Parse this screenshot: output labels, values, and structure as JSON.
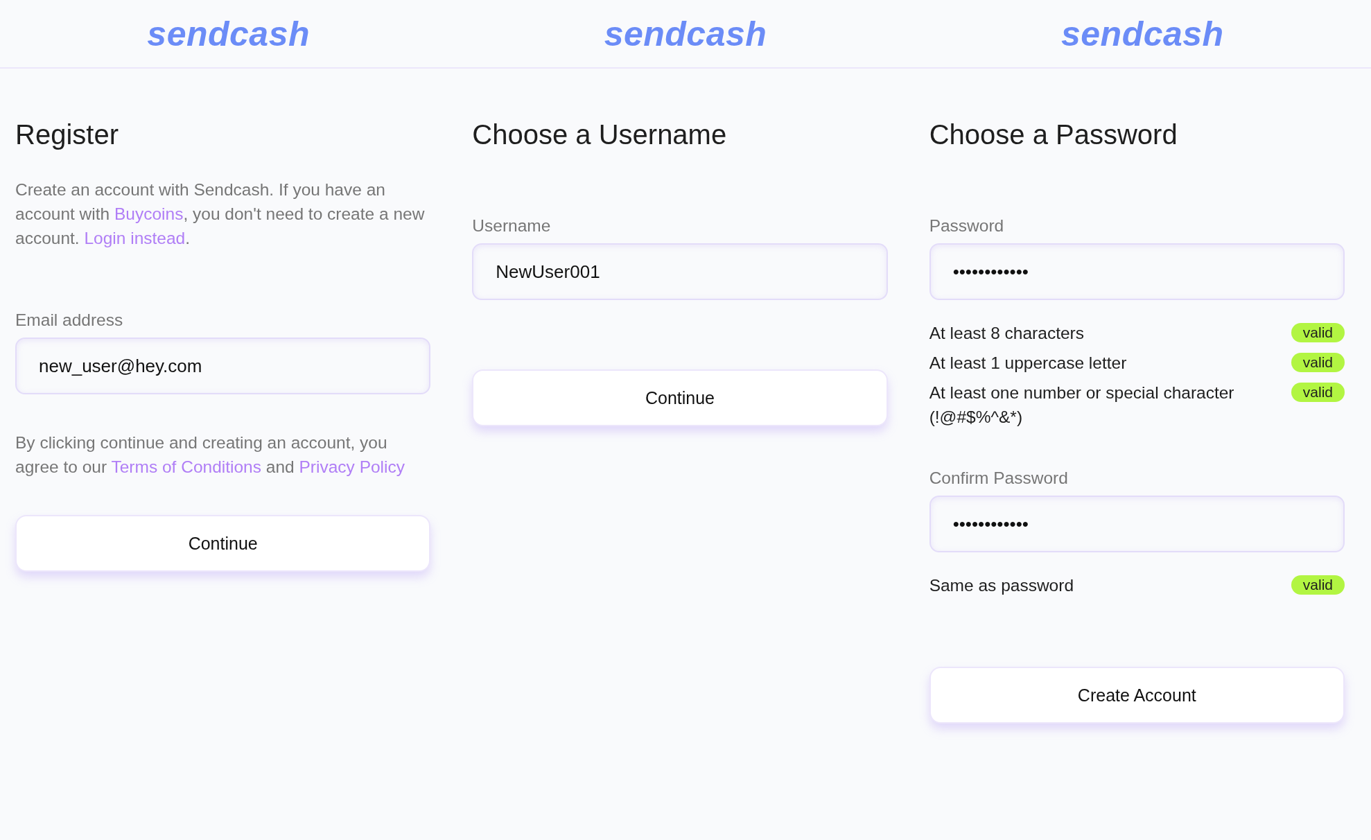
{
  "screens": [
    {
      "logo": "sendcash",
      "title": "Register",
      "blocks": [
        {
          "kind": "paragraph",
          "parts": [
            {
              "kind": "text",
              "text": "Create an account with Sendcash. If you have an account with "
            },
            {
              "kind": "link",
              "text": "Buycoins"
            },
            {
              "kind": "text",
              "text": ", you don't need to create a new account. "
            },
            {
              "kind": "link",
              "text": "Login instead"
            },
            {
              "kind": "text",
              "text": "."
            }
          ]
        },
        {
          "kind": "field",
          "label": "Email address",
          "value": "new_user@hey.com"
        },
        {
          "kind": "paragraph",
          "parts": [
            {
              "kind": "text",
              "text": "By clicking continue and creating an account, you agree to our "
            },
            {
              "kind": "link",
              "text": "Terms of Conditions"
            },
            {
              "kind": "text",
              "text": " and "
            },
            {
              "kind": "link",
              "text": "Privacy Policy"
            }
          ]
        },
        {
          "kind": "button",
          "label": "Continue"
        }
      ]
    },
    {
      "logo": "sendcash",
      "title": "Choose a Username",
      "blocks": [
        {
          "kind": "field",
          "label": "Username",
          "value": "NewUser001"
        },
        {
          "kind": "button",
          "label": "Continue"
        }
      ]
    },
    {
      "logo": "sendcash",
      "title": "Choose a Password",
      "blocks": [
        {
          "kind": "field",
          "label": "Password",
          "value": "••••••••••••"
        },
        {
          "kind": "rules",
          "items": [
            {
              "text": "At least 8 characters",
              "badge": "valid"
            },
            {
              "text": "At least 1 uppercase letter",
              "badge": "valid"
            },
            {
              "text": "At least one number or special character (!@#$%^&*)",
              "badge": "valid"
            }
          ]
        },
        {
          "kind": "field",
          "label": "Confirm Password",
          "value": "••••••••••••"
        },
        {
          "kind": "rules",
          "items": [
            {
              "text": "Same as password",
              "badge": "valid"
            }
          ]
        },
        {
          "kind": "button",
          "label": "Create Account"
        }
      ]
    }
  ]
}
